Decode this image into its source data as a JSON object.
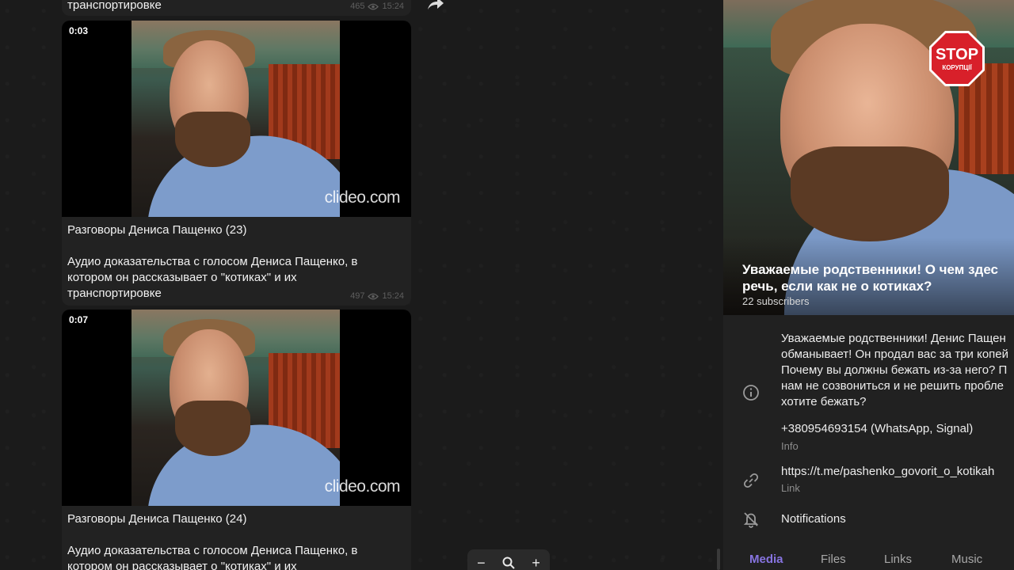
{
  "chat": {
    "prev_message": {
      "last_line": "транспортировке",
      "views": "465",
      "time": "15:24"
    },
    "messages": [
      {
        "duration": "0:03",
        "watermark": "clideo.com",
        "title": "Разговоры Дениса Пащенко (23)",
        "body": [
          "Аудио доказательства с голосом Дениса Пащенко, в",
          "котором он рассказывает о \"котиках\" и их",
          "транспортировке"
        ],
        "views": "497",
        "time": "15:24"
      },
      {
        "duration": "0:07",
        "watermark": "clideo.com",
        "title": "Разговоры Дениса Пащенко (24)",
        "body": [
          "Аудио доказательства с голосом Дениса Пащенко, в",
          "котором он рассказывает о \"котиках\" и их"
        ],
        "views": "",
        "time": ""
      }
    ],
    "zoom": {
      "minus": "−",
      "plus": "+"
    }
  },
  "panel": {
    "stop_sign": {
      "top": "STOP",
      "bottom": "КОРУПЦІЇ"
    },
    "channel_title": [
      "Уважаемые родственники! О чем здес",
      "речь, если как не о котиках?"
    ],
    "subscribers": "22 subscribers",
    "description": [
      "Уважаемые родственники! Денис Пащен",
      "обманывает! Он продал вас за три копей",
      "Почему вы должны бежать из-за него? П",
      "нам не созвониться и не решить пробле",
      "хотите бежать?"
    ],
    "phone": "+380954693154 (WhatsApp, Signal)",
    "phone_caption": "Info",
    "link": "https://t.me/pashenko_govorit_o_kotikah",
    "link_caption": "Link",
    "notifications": "Notifications",
    "tabs": [
      "Media",
      "Files",
      "Links",
      "Music"
    ]
  },
  "colors": {
    "accent": "#8774e1",
    "stop_red": "#d8202a",
    "meta": "#5e5e5e"
  },
  "icons": [
    "forward-icon",
    "eye-icon",
    "zoom-out-icon",
    "zoom-search-icon",
    "zoom-in-icon",
    "info-icon",
    "link-icon",
    "bell-off-icon"
  ]
}
